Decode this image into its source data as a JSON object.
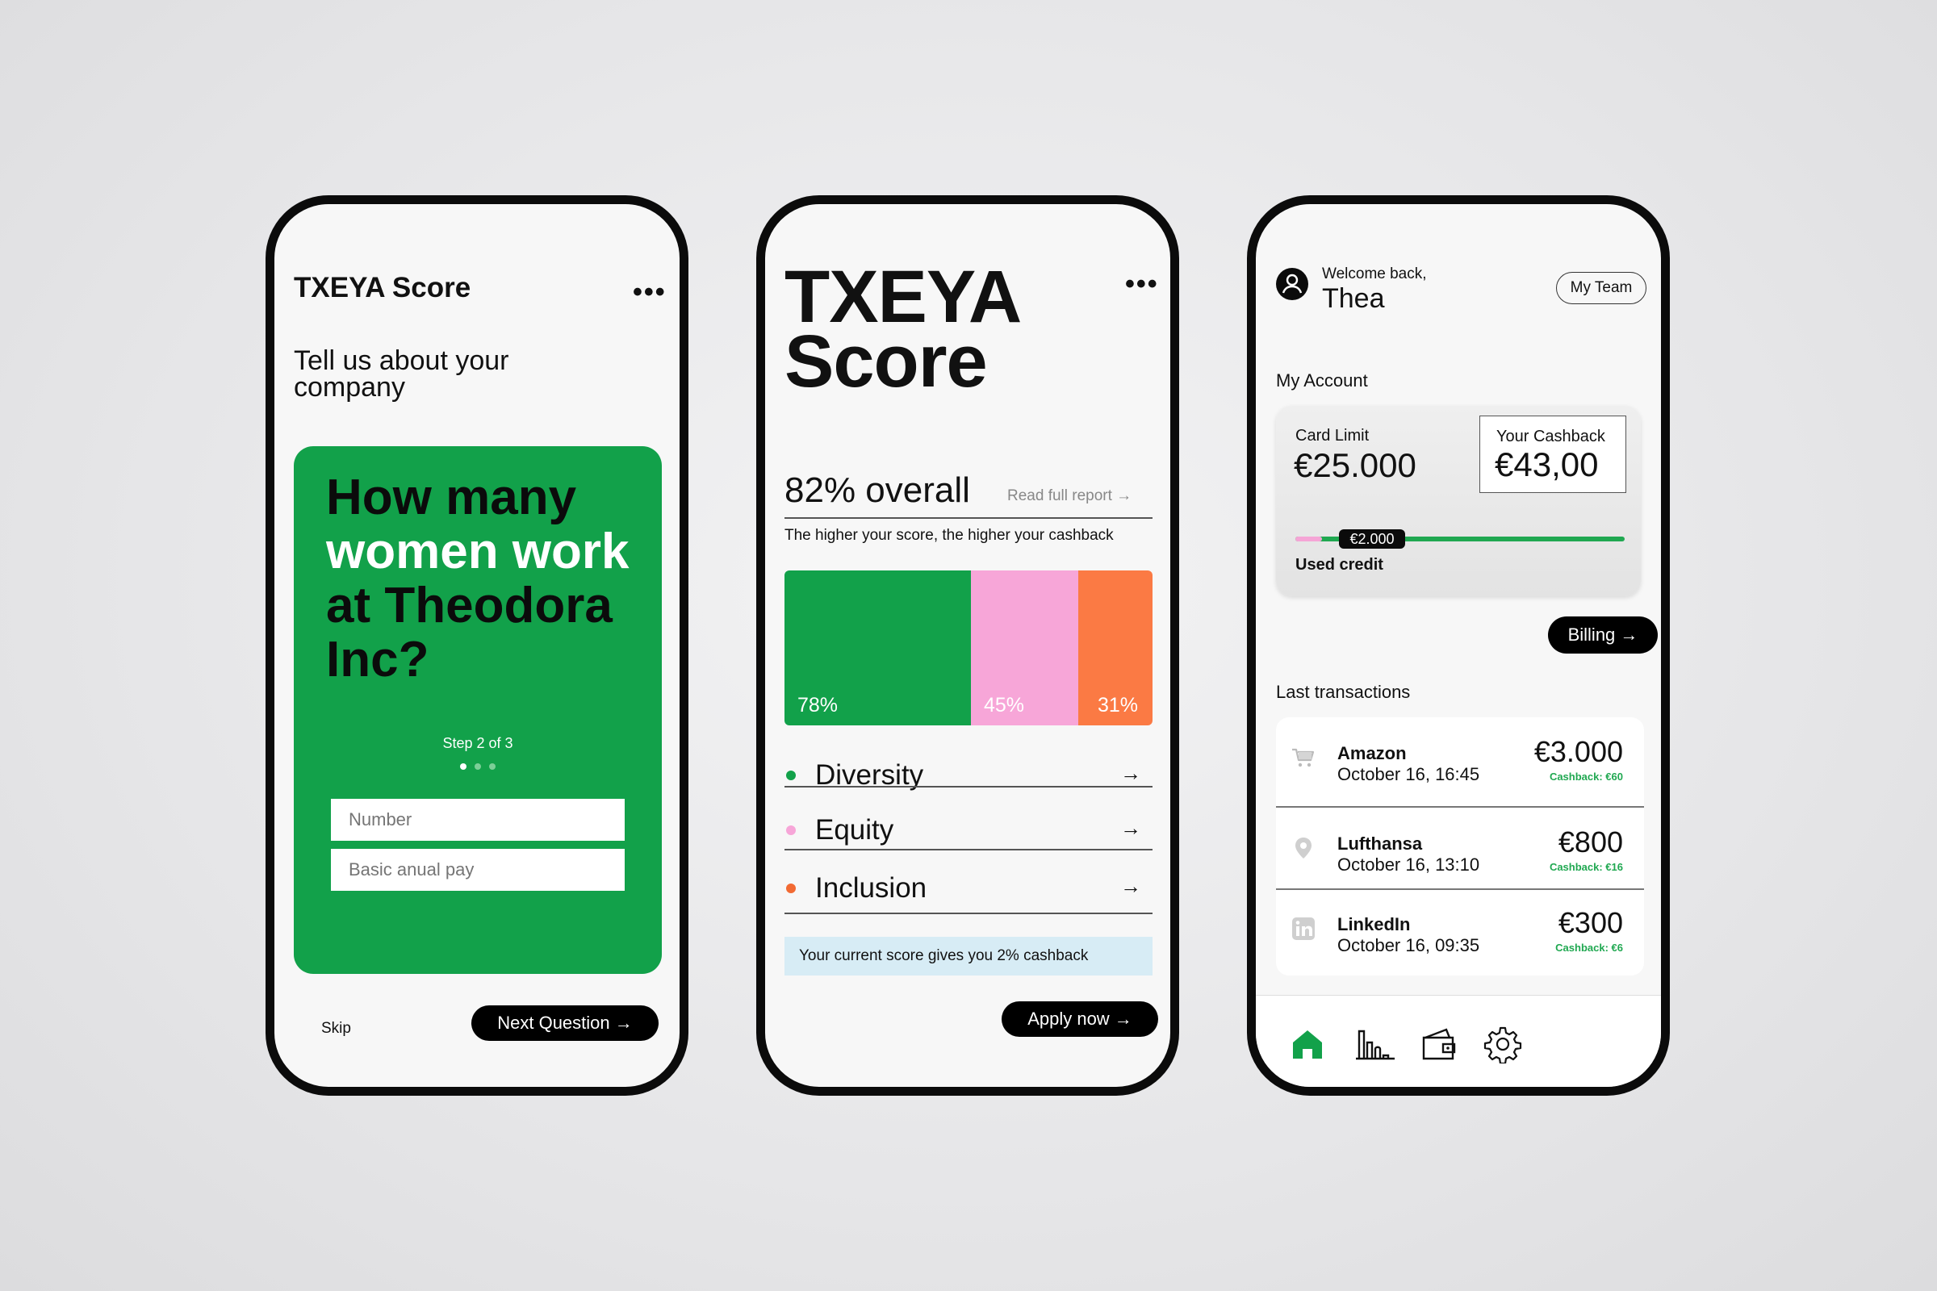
{
  "screen1": {
    "title": "TXEYA Score",
    "more": "•••",
    "subtitle": "Tell us about your company",
    "question_dark_1": "How many",
    "question_white": "women work",
    "question_dark_2": "at Theodora Inc?",
    "step": "Step 2 of 3",
    "field_number": "Number",
    "field_pay": "Basic anual pay",
    "skip": "Skip",
    "next": "Next Question →"
  },
  "screen2": {
    "title_line1": "TXEYA",
    "title_line2": "Score",
    "more": "•••",
    "overall": "82% overall",
    "read_full": "Read full report →",
    "lead": "The higher your score, the higher your cashback",
    "rows": [
      {
        "label": "Diversity",
        "color": "#12a14a"
      },
      {
        "label": "Equity",
        "color": "#f7a6d8"
      },
      {
        "label": "Inclusion",
        "color": "#f26a33"
      }
    ],
    "arrow": "→",
    "note": "Your current score gives you 2% cashback",
    "apply": "Apply now →"
  },
  "chart_data": {
    "type": "bar",
    "categories": [
      "Diversity",
      "Equity",
      "Inclusion"
    ],
    "values": [
      78,
      45,
      31
    ],
    "labels": [
      "78%",
      "45%",
      "31%"
    ],
    "colors": [
      "#12a14a",
      "#f7a6d8",
      "#fb7a44"
    ]
  },
  "screen3": {
    "welcome": "Welcome back,",
    "name": "Thea",
    "my_team": "My Team",
    "my_account": "My Account",
    "card_limit_label": "Card Limit",
    "card_limit": "€25.000",
    "cashback_label": "Your Cashback",
    "cashback": "€43,00",
    "used_amount": "€2.000",
    "used_label": "Used credit",
    "used_fraction": 0.08,
    "billing": "Billing →",
    "last_transactions": "Last transactions",
    "transactions": [
      {
        "merchant": "Amazon",
        "date": "October 16, 16:45",
        "amount": "€3.000",
        "cashback": "Cashback: €60",
        "icon": "cart-icon"
      },
      {
        "merchant": "Lufthansa",
        "date": "October 16, 13:10",
        "amount": "€800",
        "cashback": "Cashback: €16",
        "icon": "location-pin-icon"
      },
      {
        "merchant": "LinkedIn",
        "date": "October 16, 09:35",
        "amount": "€300",
        "cashback": "Cashback: €6",
        "icon": "linkedin-icon"
      }
    ],
    "tabs": [
      "home-icon",
      "chart-icon",
      "wallet-icon",
      "settings-icon"
    ],
    "accent": "#12a14a"
  }
}
